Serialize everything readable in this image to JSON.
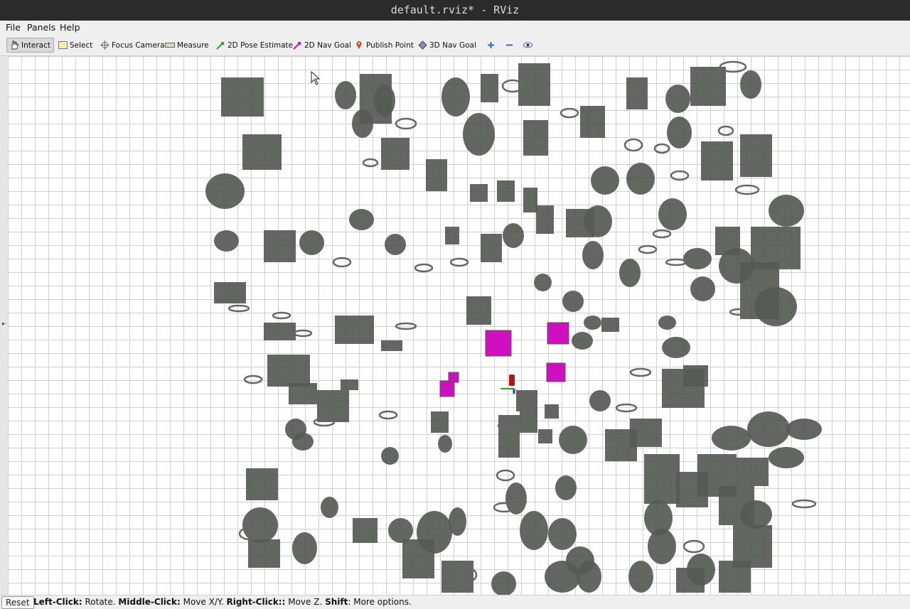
{
  "window": {
    "title": "default.rviz* - RViz"
  },
  "menu": {
    "file": "File",
    "panels": "Panels",
    "help": "Help"
  },
  "toolbar": {
    "tools": [
      {
        "label": "Interact",
        "icon": "hand-icon",
        "active": true
      },
      {
        "label": "Select",
        "icon": "select-rect-icon"
      },
      {
        "label": "Focus Camera",
        "icon": "crosshair-icon"
      },
      {
        "label": "Measure",
        "icon": "ruler-icon"
      },
      {
        "label": "2D Pose Estimate",
        "icon": "green-arrow-icon"
      },
      {
        "label": "2D Nav Goal",
        "icon": "magenta-arrow-icon"
      },
      {
        "label": "Publish Point",
        "icon": "map-pin-icon"
      },
      {
        "label": "3D Nav Goal",
        "icon": "cube-icon"
      }
    ],
    "extra_icons": [
      "plus-icon",
      "minus-icon",
      "eye-icon"
    ]
  },
  "status": {
    "reset": "Reset",
    "left_click_label": "Left-Click:",
    "left_click_text": "Rotate.",
    "middle_click_label": "Middle-Click:",
    "middle_click_text": "Move X/Y.",
    "right_click_label": "Right-Click::",
    "right_click_text": "Move Z.",
    "shift_label": "Shift",
    "shift_text": ": More options."
  },
  "colors": {
    "obstacle": "#555a55",
    "highlight": "#d010c0",
    "grid": "#cfcfcf",
    "robot": "#b01818"
  }
}
